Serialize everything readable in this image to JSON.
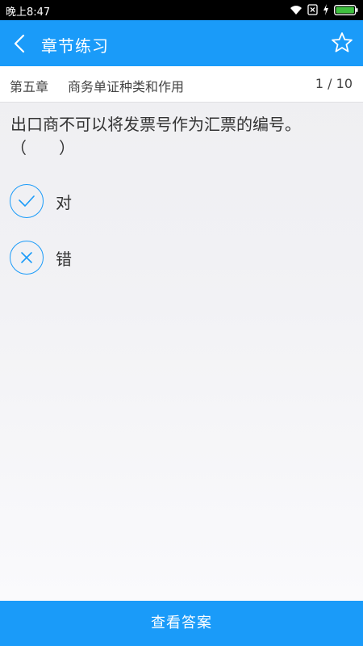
{
  "status_bar": {
    "time": "晚上8:47",
    "icons": [
      "wifi-icon",
      "no-sim-icon",
      "charging-icon",
      "battery-icon"
    ]
  },
  "header": {
    "title": "章节练习",
    "back_icon": "chevron-left-icon",
    "star_icon": "star-outline-icon"
  },
  "chapter": {
    "chapter_label": "第五章",
    "section_label": "商务单证种类和作用",
    "progress": "1 / 10"
  },
  "question": {
    "line1": "出口商不可以将发票号作为汇票的编号。",
    "line2": "（　　）"
  },
  "options": [
    {
      "label": "对",
      "icon": "check-icon"
    },
    {
      "label": "错",
      "icon": "cross-icon"
    }
  ],
  "footer": {
    "button_label": "查看答案"
  },
  "colors": {
    "accent": "#1a9bf9",
    "statusbar": "#000000",
    "text": "#333333"
  }
}
